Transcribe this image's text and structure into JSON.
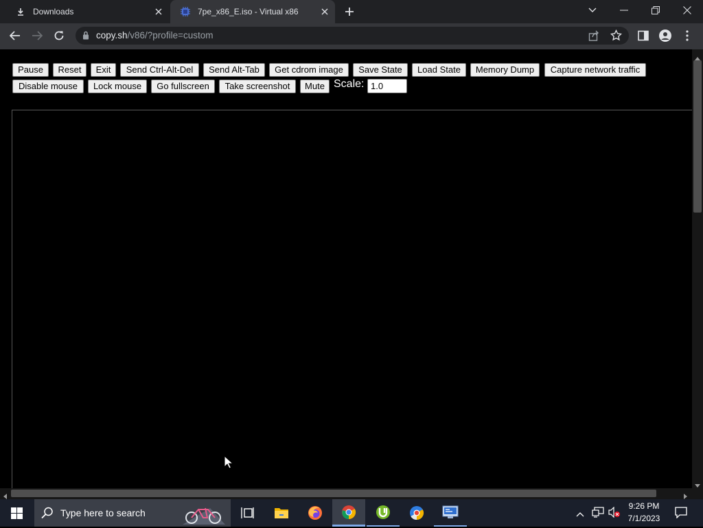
{
  "browser": {
    "tabs": [
      {
        "title": "Downloads",
        "icon": "download-icon",
        "active": false
      },
      {
        "title": "7pe_x86_E.iso - Virtual x86",
        "icon": "v86-favicon",
        "active": true
      }
    ],
    "address": {
      "host": "copy.sh",
      "path": "/v86/?profile=custom"
    }
  },
  "toolbar_buttons": {
    "row1": [
      "Pause",
      "Reset",
      "Exit",
      "Send Ctrl-Alt-Del",
      "Send Alt-Tab",
      "Get cdrom image",
      "Save State",
      "Load State",
      "Memory Dump",
      "Capture network traffic"
    ],
    "row2": [
      "Disable mouse",
      "Lock mouse",
      "Go fullscreen",
      "Take screenshot",
      "Mute"
    ]
  },
  "scale": {
    "label": "Scale:",
    "value": "1.0"
  },
  "taskbar": {
    "search_placeholder": "Type here to search",
    "time": "9:26 PM",
    "date": "7/1/2023",
    "apps": [
      "task-view-icon",
      "file-explorer-icon",
      "firefox-icon",
      "chrome-icon",
      "utorrent-icon",
      "chromium-browser-icon",
      "remote-desktop-icon"
    ]
  },
  "colors": {
    "tab_strip": "#202124",
    "toolbar": "#35363a",
    "page_bg": "#000000",
    "taskbar": "#1a1f2b"
  }
}
